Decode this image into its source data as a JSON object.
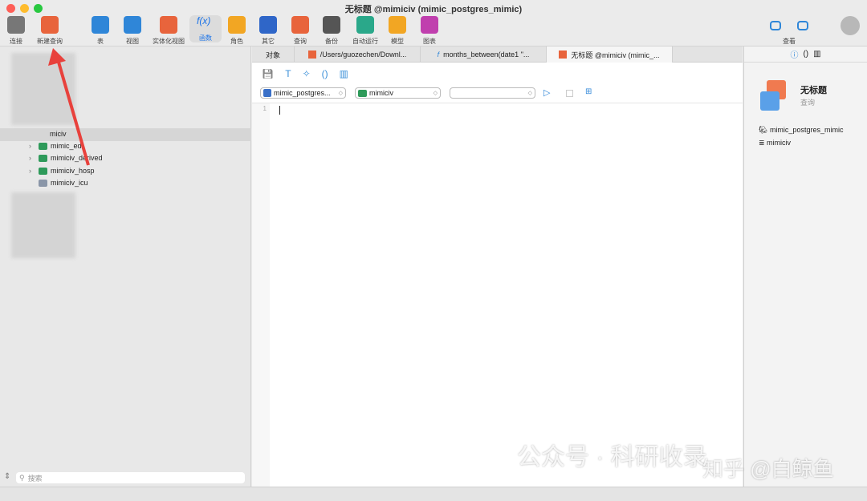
{
  "window": {
    "title": "无标题 @mimiciv (mimic_postgres_mimic)"
  },
  "toolbar": [
    {
      "label": "连接",
      "icon": "plug-icon",
      "color": "#777"
    },
    {
      "label": "新建查询",
      "icon": "new-query-icon",
      "color": "#e8643c"
    },
    {
      "label": "表",
      "icon": "table-icon",
      "color": "#2f86d8"
    },
    {
      "label": "视图",
      "icon": "view-icon",
      "color": "#2f86d8"
    },
    {
      "label": "实体化视图",
      "icon": "materialized-view-icon",
      "color": "#e8643c"
    },
    {
      "label": "函数",
      "icon": "function-icon",
      "color": "#1a73e8"
    },
    {
      "label": "角色",
      "icon": "role-icon",
      "color": "#f2a623"
    },
    {
      "label": "其它",
      "icon": "tools-icon",
      "color": "#2f66c8"
    },
    {
      "label": "查询",
      "icon": "query-icon",
      "color": "#e8643c"
    },
    {
      "label": "备份",
      "icon": "backup-icon",
      "color": "#555"
    },
    {
      "label": "自动运行",
      "icon": "robot-icon",
      "color": "#2aa88a"
    },
    {
      "label": "模型",
      "icon": "model-icon",
      "color": "#f2a623"
    },
    {
      "label": "图表",
      "icon": "chart-icon",
      "color": "#c03fae"
    }
  ],
  "view_label": "查看",
  "tree": {
    "root": "miciv",
    "items": [
      "mimic_ed",
      "mimiciv_derived",
      "mimiciv_hosp",
      "mimiciv_icu"
    ]
  },
  "search_placeholder": "搜索",
  "tabs": [
    "对象",
    "/Users/guozechen/Downl...",
    "months_between(date1 \"...",
    "无标题 @mimiciv (mimic_..."
  ],
  "editor": {
    "connection": "mimic_postgres...",
    "database": "mimiciv",
    "schema": "",
    "line": "1"
  },
  "info": {
    "title": "无标题",
    "type": "查询",
    "connection": "mimic_postgres_mimic",
    "database": "mimiciv"
  },
  "watermark": {
    "left": "公众号 · 科研收录",
    "right": "知乎 @白鲸鱼"
  }
}
